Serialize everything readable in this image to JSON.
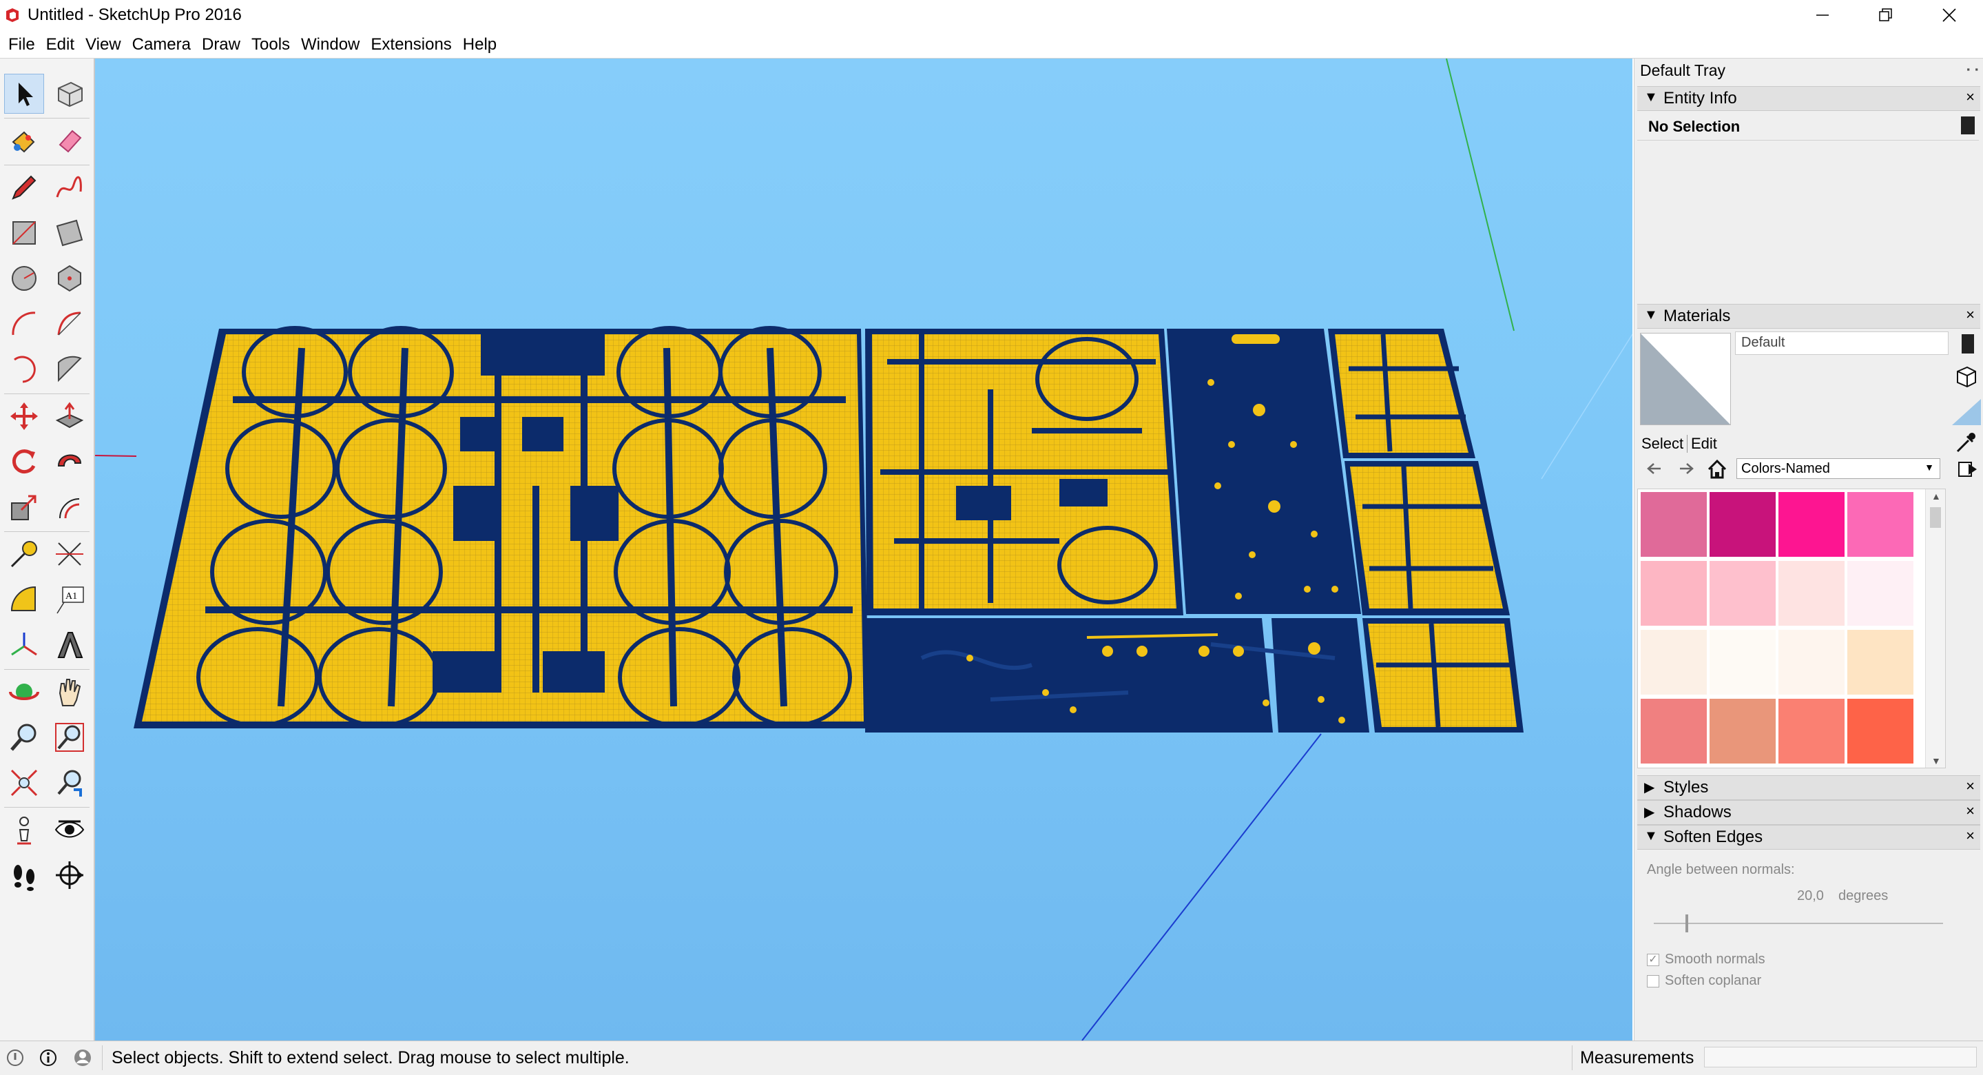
{
  "window": {
    "title": "Untitled - SketchUp Pro 2016",
    "controls": [
      "minimize-icon",
      "restore-icon",
      "close-icon"
    ]
  },
  "menu": [
    "File",
    "Edit",
    "View",
    "Camera",
    "Draw",
    "Tools",
    "Window",
    "Extensions",
    "Help"
  ],
  "toolbar": {
    "tools": [
      "select",
      "component",
      "paint-bucket",
      "eraser",
      "line",
      "freehand",
      "rectangle",
      "rotated-rectangle",
      "circle",
      "polygon",
      "arc",
      "pie",
      "two-point-arc",
      "three-point-arc",
      "move",
      "push-pull",
      "rotate",
      "follow-me",
      "scale",
      "offset",
      "tape-measure",
      "dimension",
      "protractor",
      "text",
      "axes",
      "3d-text",
      "orbit",
      "pan",
      "zoom",
      "zoom-window",
      "zoom-extents",
      "previous-view",
      "position-camera",
      "look-around",
      "walk",
      "section-plane"
    ],
    "text_tool_label": "A1"
  },
  "tray": {
    "title": "Default Tray",
    "entity_info": {
      "label": "Entity Info",
      "selection": "No Selection"
    },
    "materials": {
      "label": "Materials",
      "current": "Default",
      "tabs": [
        "Select",
        "Edit"
      ],
      "library": "Colors-Named",
      "swatches": [
        "#e06a99",
        "#c8137b",
        "#fd1591",
        "#fc69b6",
        "#fdb6c3",
        "#fec0cd",
        "#fee3e2",
        "#fef0f5",
        "#fcf0e6",
        "#fefaf5",
        "#fef5ee",
        "#fee4c3",
        "#f08080",
        "#e9967a",
        "#fa8072",
        "#fe6348"
      ]
    },
    "collapsed_panels": [
      "Styles",
      "Shadows"
    ],
    "soften_edges": {
      "label": "Soften Edges",
      "angle_label": "Angle between normals:",
      "angle_value": "20,0",
      "angle_unit": "degrees",
      "angle_fraction": 0.11,
      "smooth_normals": "Smooth normals",
      "smooth_normals_checked": true,
      "soften_coplanar": "Soften coplanar",
      "soften_coplanar_checked": false
    }
  },
  "status": {
    "message": "Select objects. Shift to extend select. Drag mouse to select multiple.",
    "measurements_label": "Measurements",
    "measurements_value": ""
  },
  "colors": {
    "sky": "#86cdfa",
    "pcb_board": "#0c2b6b",
    "copper": "#f2c316",
    "axis_red": "#c8143c",
    "axis_green": "#31b14b",
    "axis_blue": "#1a3ccf"
  }
}
